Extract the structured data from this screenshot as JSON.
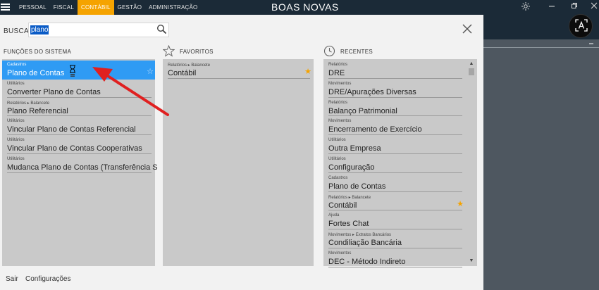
{
  "topbar": {
    "menu": [
      "PESSOAL",
      "FISCAL",
      "CONTÁBIL",
      "GESTÃO",
      "ADMINISTRAÇÃO"
    ],
    "active_index": 2,
    "app_title": "BOAS NOVAS",
    "accent_color": "#f5a300"
  },
  "search": {
    "label": "BUSCA",
    "value": "plano",
    "icon": "search-icon"
  },
  "columns": {
    "funcoes_title": "FUNÇÕES DO SISTEMA",
    "favoritos_title": "FAVORITOS",
    "recentes_title": "RECENTES"
  },
  "funcoes": [
    {
      "category": "Cadastros",
      "name": "Plano de Contas",
      "selected": true
    },
    {
      "category": "Utilitários",
      "name": "Converter Plano de Contas"
    },
    {
      "category": "Relatórios ▸ Balancete",
      "name": "Plano Referencial"
    },
    {
      "category": "Utilitários",
      "name": "Vincular Plano de Contas Referencial"
    },
    {
      "category": "Utilitários",
      "name": "Vincular Plano de Contas Cooperativas"
    },
    {
      "category": "Utilitários",
      "name": "Mudanca Plano de Contas (Transferência S"
    }
  ],
  "favoritos": [
    {
      "category": "Relatórios ▸ Balancete",
      "name": "Contábil",
      "starred": true
    }
  ],
  "recentes": [
    {
      "category": "Relatórios",
      "name": "DRE"
    },
    {
      "category": "Movimentos",
      "name": "DRE/Apurações Diversas"
    },
    {
      "category": "Relatórios",
      "name": "Balanço Patrimonial"
    },
    {
      "category": "Movimentos",
      "name": "Encerramento de Exercício"
    },
    {
      "category": "Utilitários",
      "name": "Outra Empresa"
    },
    {
      "category": "Utilitários",
      "name": "Configuração"
    },
    {
      "category": "Cadastros",
      "name": "Plano de Contas"
    },
    {
      "category": "Relatórios ▸ Balancete",
      "name": "Contábil",
      "starred": true
    },
    {
      "category": "Ajuda",
      "name": "Fortes Chat"
    },
    {
      "category": "Movimentos ▸ Extratos Bancários",
      "name": "Condiliação Bancária"
    },
    {
      "category": "Movimentos",
      "name": "DEC - Método Indireto"
    }
  ],
  "footer": {
    "sair": "Sair",
    "configuracoes": "Configurações"
  }
}
